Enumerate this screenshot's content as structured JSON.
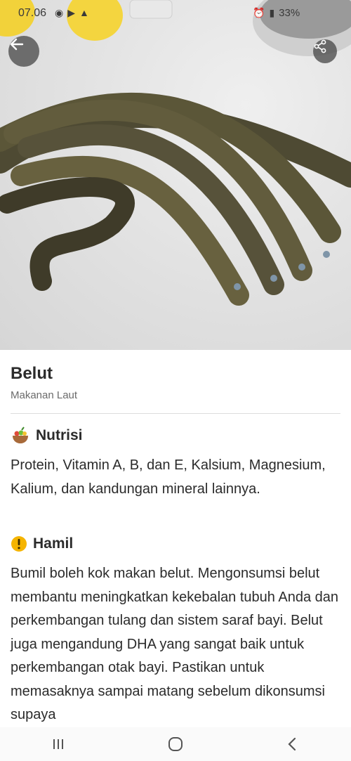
{
  "status": {
    "time": "07.06",
    "battery": "33%"
  },
  "header": {
    "back_icon": "arrow-left-icon",
    "share_icon": "share-icon"
  },
  "food": {
    "name": "Belut",
    "category": "Makanan Laut"
  },
  "sections": {
    "nutrition": {
      "icon": "food-bowl-icon",
      "title": "Nutrisi",
      "text": "Protein, Vitamin A, B, dan E, Kalsium, Magnesium, Kalium, dan kandungan mineral lainnya."
    },
    "pregnancy": {
      "icon": "warning-circle-icon",
      "title": "Hamil",
      "text": "Bumil boleh kok makan belut. Mengonsumsi belut membantu meningkatkan kekebalan tubuh Anda dan perkembangan tulang dan sistem saraf bayi. Belut juga mengandung DHA yang sangat baik untuk perkembangan otak bayi. Pastikan untuk memasaknya sampai matang sebelum dikonsumsi supaya"
    }
  },
  "colors": {
    "warning": "#f5b400",
    "text": "#2b2b2b",
    "muted": "#6b6b6b"
  },
  "navbar": {
    "recent_icon": "recent-apps-icon",
    "home_icon": "home-icon",
    "back_icon": "nav-back-icon"
  }
}
